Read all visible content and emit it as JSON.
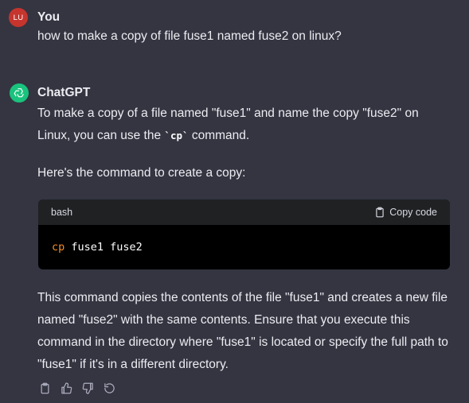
{
  "user_message": {
    "avatar_initials": "LU",
    "author": "You",
    "text": "how to make a copy of file fuse1 named fuse2 on linux?"
  },
  "assistant_message": {
    "author": "ChatGPT",
    "para1_before": "To make a copy of a file named \"fuse1\" and name the copy \"fuse2\" on Linux, you can use the ",
    "para1_code": "`cp`",
    "para1_after": " command.",
    "para2": "Here's the command to create a copy:",
    "code_block": {
      "language": "bash",
      "copy_label": "Copy code",
      "code_keyword": "cp",
      "code_args": " fuse1 fuse2"
    },
    "para3": "This command copies the contents of the file \"fuse1\" and creates a new file named \"fuse2\" with the same contents. Ensure that you execute this command in the directory where \"fuse1\" is located or specify the full path to \"fuse1\" if it's in a different directory."
  },
  "actions": {
    "icons": [
      "clipboard-icon",
      "thumbs-up-icon",
      "thumbs-down-icon",
      "regenerate-icon"
    ]
  },
  "colors": {
    "background": "#343541",
    "user_avatar": "#c5352e",
    "assistant_avatar": "#19c37d",
    "code_header": "#202123",
    "code_body": "#000000",
    "keyword": "#f28c28"
  }
}
